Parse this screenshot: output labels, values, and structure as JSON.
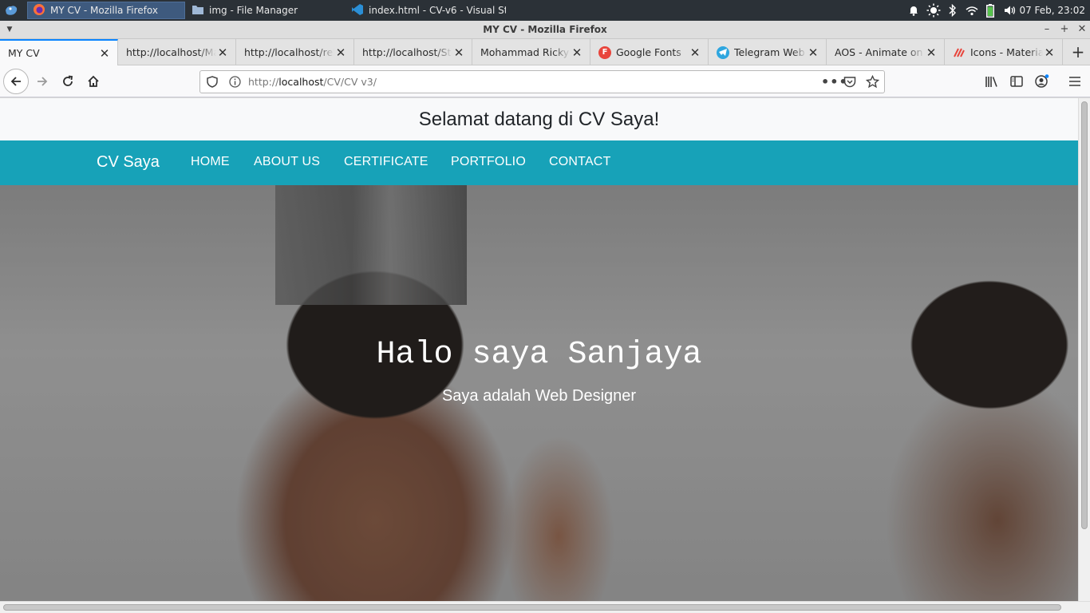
{
  "taskbar": {
    "tasks": [
      {
        "label": "MY CV - Mozilla Firefox",
        "icon": "firefox-icon"
      },
      {
        "label": "img - File Manager",
        "icon": "folder-icon"
      },
      {
        "label": "index.html - CV-v6 - Visual St...",
        "icon": "vscode-icon"
      }
    ],
    "clock": "07 Feb, 23:02"
  },
  "window": {
    "title": "MY CV - Mozilla Firefox"
  },
  "tabs": [
    {
      "label": "MY CV",
      "active": true
    },
    {
      "label": "http://localhost/Ma"
    },
    {
      "label": "http://localhost/reb"
    },
    {
      "label": "http://localhost/Ste"
    },
    {
      "label": "Mohammad Ricky S"
    },
    {
      "label": "Google Fonts",
      "icon": "google-fonts-icon"
    },
    {
      "label": "Telegram Web",
      "icon": "telegram-icon"
    },
    {
      "label": "AOS - Animate on sc"
    },
    {
      "label": "Icons - Material",
      "icon": "material-icon"
    }
  ],
  "navbar": {
    "url_prefix": "http://",
    "url_host": "localhost",
    "url_path": "/CV/CV v3/"
  },
  "page": {
    "welcome": "Selamat datang di CV Saya!",
    "brand": "CV Saya",
    "menu": [
      "HOME",
      "ABOUT US",
      "CERTIFICATE",
      "PORTFOLIO",
      "CONTACT"
    ],
    "hero_title": "Halo saya Sanjaya",
    "hero_subtitle": "Saya adalah Web Designer"
  },
  "colors": {
    "nav_bg": "#17a2b8",
    "active_tab_accent": "#0a84ff"
  }
}
